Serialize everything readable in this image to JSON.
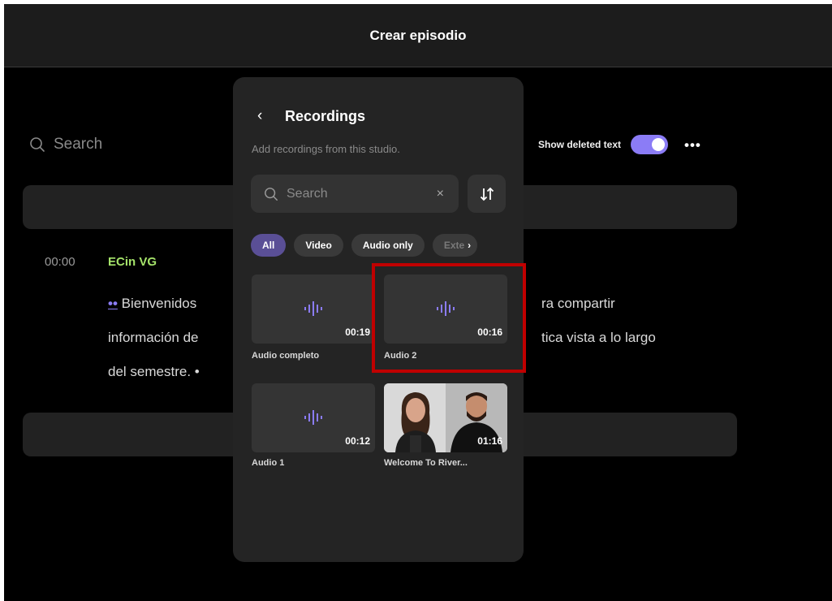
{
  "header": {
    "title": "Crear episodio"
  },
  "editor": {
    "search_placeholder": "Search",
    "show_deleted_label": "Show deleted text",
    "show_deleted_on": true,
    "more_label": "•••",
    "transcript": {
      "timestamp": "00:00",
      "speaker": "ECin VG",
      "line1_marker": "••",
      "line1_left": "Bienvenidos",
      "line1_right": "ra compartir",
      "line2_left": "información de",
      "line2_right": "tica vista a lo largo",
      "line3": "del semestre. •"
    }
  },
  "panel": {
    "back_icon": "‹",
    "title": "Recordings",
    "subtitle": "Add recordings from this studio.",
    "search": {
      "placeholder": "Search",
      "clear": "×"
    },
    "filters": [
      {
        "label": "All",
        "active": true
      },
      {
        "label": "Video",
        "active": false
      },
      {
        "label": "Audio only",
        "active": false
      },
      {
        "label": "Exte",
        "active": false,
        "more": "›"
      }
    ],
    "recordings": [
      {
        "name": "Audio completo",
        "duration": "00:19",
        "kind": "audio"
      },
      {
        "name": "Audio 2",
        "duration": "00:16",
        "kind": "audio"
      },
      {
        "name": "Audio 1",
        "duration": "00:12",
        "kind": "audio"
      },
      {
        "name": "Welcome To River...",
        "duration": "01:16",
        "kind": "video"
      }
    ]
  },
  "colors": {
    "accent": "#8b7cf6",
    "speaker": "#a5e36a",
    "highlight": "#c00000",
    "background": "#000000",
    "panel": "#242424"
  }
}
